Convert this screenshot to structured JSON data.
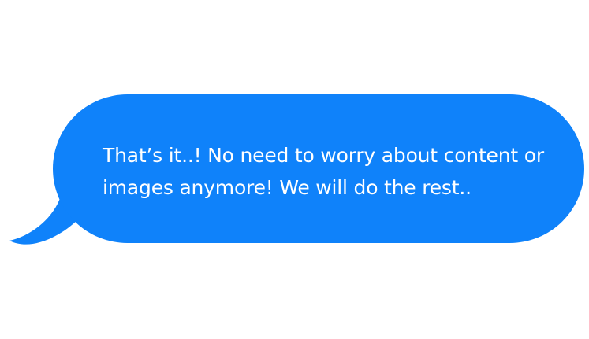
{
  "message": {
    "text_line_1": "That’s it..! No need to worry about content or",
    "text_line_2": "images anymore! We will do the rest.."
  },
  "colors": {
    "bubble": "#0f82fa",
    "text": "#ffffff",
    "background": "#ffffff"
  }
}
